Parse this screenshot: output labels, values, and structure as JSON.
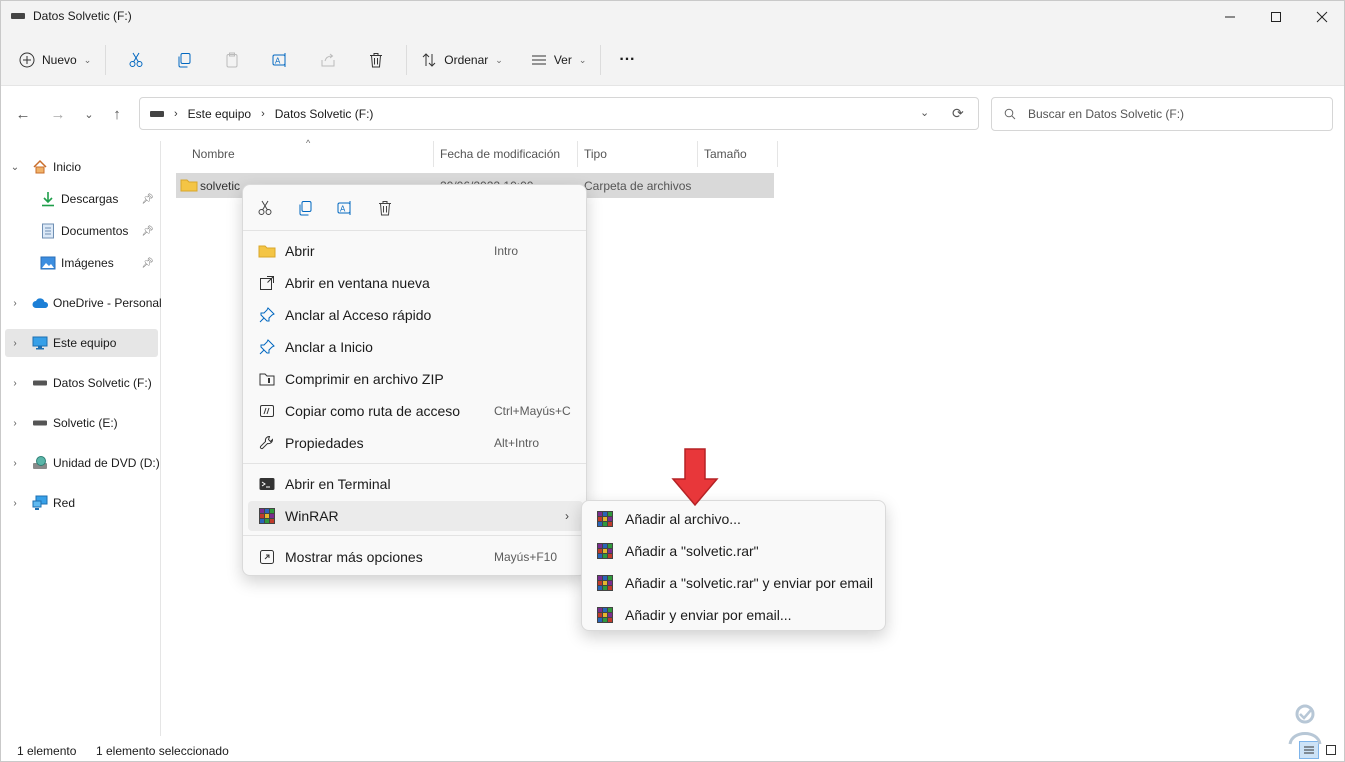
{
  "window": {
    "title": "Datos Solvetic (F:)",
    "controls": [
      "minimize",
      "maximize",
      "close"
    ]
  },
  "toolbar": {
    "new_label": "Nuevo",
    "sort_label": "Ordenar",
    "view_label": "Ver",
    "more_label": "···"
  },
  "address": {
    "crumbs": [
      "Este equipo",
      "Datos Solvetic (F:)"
    ]
  },
  "search": {
    "placeholder": "Buscar en Datos Solvetic (F:)"
  },
  "sidebar": {
    "items": [
      {
        "label": "Inicio"
      },
      {
        "label": "Descargas"
      },
      {
        "label": "Documentos"
      },
      {
        "label": "Imágenes"
      },
      {
        "label": "OneDrive - Personal"
      },
      {
        "label": "Este equipo"
      },
      {
        "label": "Datos Solvetic (F:)"
      },
      {
        "label": "Solvetic (E:)"
      },
      {
        "label": "Unidad de DVD (D:)"
      },
      {
        "label": "Red"
      }
    ]
  },
  "columns": {
    "name": "Nombre",
    "date": "Fecha de modificación",
    "type": "Tipo",
    "size": "Tamaño"
  },
  "files": [
    {
      "name": "solvetic",
      "date": "20/06/2022 10:00",
      "type": "Carpeta de archivos"
    }
  ],
  "context_menu": {
    "items": [
      {
        "label": "Abrir",
        "shortcut": "Intro"
      },
      {
        "label": "Abrir en ventana nueva",
        "shortcut": ""
      },
      {
        "label": "Anclar al Acceso rápido",
        "shortcut": ""
      },
      {
        "label": "Anclar a Inicio",
        "shortcut": ""
      },
      {
        "label": "Comprimir en archivo ZIP",
        "shortcut": ""
      },
      {
        "label": "Copiar como ruta de acceso",
        "shortcut": "Ctrl+Mayús+C"
      },
      {
        "label": "Propiedades",
        "shortcut": "Alt+Intro"
      },
      {
        "label": "Abrir en Terminal",
        "shortcut": ""
      },
      {
        "label": "WinRAR",
        "shortcut": ""
      },
      {
        "label": "Mostrar más opciones",
        "shortcut": "Mayús+F10"
      }
    ]
  },
  "winrar_submenu": {
    "items": [
      {
        "label": "Añadir al archivo..."
      },
      {
        "label": "Añadir a \"solvetic.rar\""
      },
      {
        "label": "Añadir a \"solvetic.rar\" y enviar por email"
      },
      {
        "label": "Añadir y enviar por email..."
      }
    ]
  },
  "status": {
    "count": "1 elemento",
    "selected": "1 elemento seleccionado"
  },
  "colors": {
    "accent": "#0067c0",
    "folder": "#f4c545",
    "annotation_red": "#e8373a"
  }
}
